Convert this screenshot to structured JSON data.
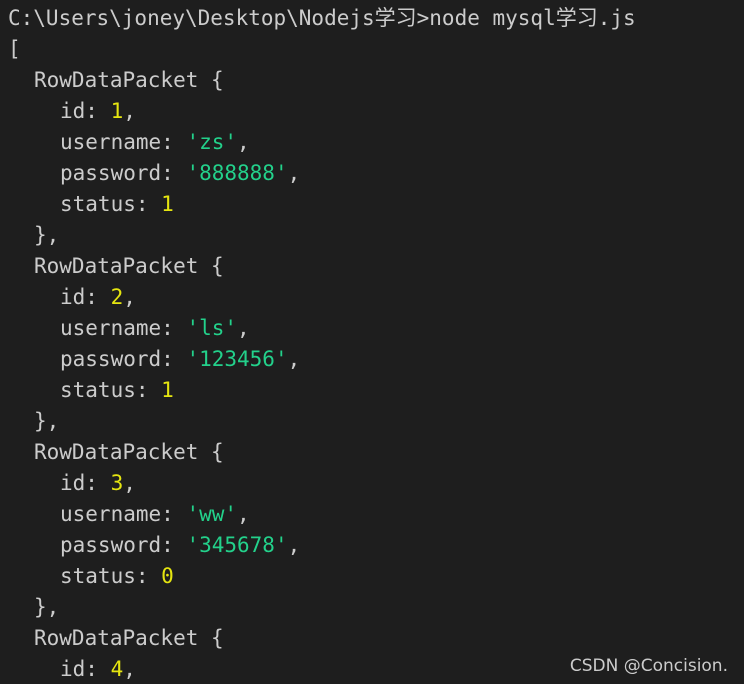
{
  "terminal": {
    "prompt_line": "C:\\Users\\joney\\Desktop\\Nodejs学习>node mysql学习.js",
    "open_bracket": "["
  },
  "records": [
    {
      "header": "RowDataPacket {",
      "id_label": "id: ",
      "id": "1",
      "username_label": "username: ",
      "username": "'zs'",
      "password_label": "password: ",
      "password": "'888888'",
      "status_label": "status: ",
      "status": "1",
      "close": "},"
    },
    {
      "header": "RowDataPacket {",
      "id_label": "id: ",
      "id": "2",
      "username_label": "username: ",
      "username": "'ls'",
      "password_label": "password: ",
      "password": "'123456'",
      "status_label": "status: ",
      "status": "1",
      "close": "},"
    },
    {
      "header": "RowDataPacket {",
      "id_label": "id: ",
      "id": "3",
      "username_label": "username: ",
      "username": "'ww'",
      "password_label": "password: ",
      "password": "'345678'",
      "status_label": "status: ",
      "status": "0",
      "close": "},"
    },
    {
      "header": "RowDataPacket {",
      "id_label": "id: ",
      "id": "4"
    }
  ],
  "punct": {
    "comma": ","
  },
  "watermark": "CSDN @Concision.",
  "colors": {
    "background": "#1e1e1e",
    "text": "#cccccc",
    "number": "#e5e510",
    "string": "#23d18b"
  }
}
